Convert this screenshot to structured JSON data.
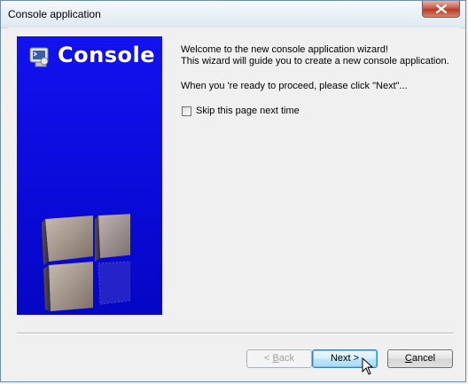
{
  "window": {
    "title": "Console application"
  },
  "banner": {
    "title": "Console"
  },
  "content": {
    "welcome_line1": "Welcome to the new console application wizard!",
    "welcome_line2": "This wizard will guide you to create a new console application.",
    "ready_text": "When you 're ready to proceed, please click \"Next\"...",
    "skip_label": "Skip this page next time",
    "skip_checked": false
  },
  "buttons": {
    "back_prefix": "< ",
    "back_underlined": "B",
    "back_rest": "ack",
    "next_label": "Next >",
    "cancel_underlined": "C",
    "cancel_rest": "ancel"
  },
  "colors": {
    "banner_blue": "#0a0ad8",
    "title_bar": "#dfe8f1",
    "close_button": "#c9513c"
  },
  "icons": [
    "close-icon",
    "console-app-icon",
    "cubes-graphic",
    "mouse-cursor-icon"
  ]
}
